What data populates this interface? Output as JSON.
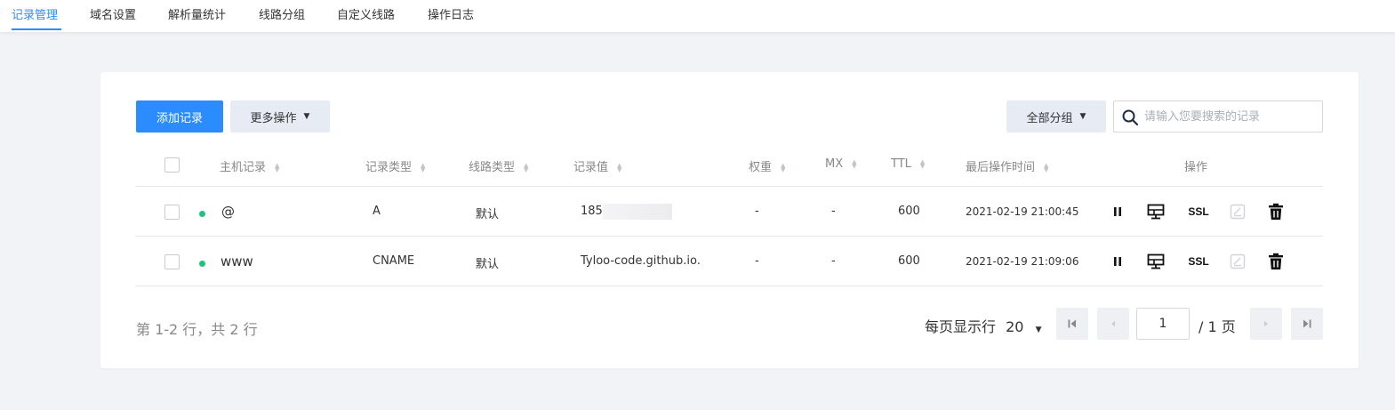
{
  "tabs": [
    {
      "label": "记录管理",
      "active": true
    },
    {
      "label": "域名设置"
    },
    {
      "label": "解析量统计"
    },
    {
      "label": "线路分组"
    },
    {
      "label": "自定义线路"
    },
    {
      "label": "操作日志"
    }
  ],
  "toolbar": {
    "add_label": "添加记录",
    "more_label": "更多操作",
    "group_label": "全部分组",
    "search_placeholder": "请输入您要搜索的记录"
  },
  "table": {
    "headers": {
      "host": "主机记录",
      "type": "记录类型",
      "line": "线路类型",
      "value": "记录值",
      "weight": "权重",
      "mx": "MX",
      "ttl": "TTL",
      "time": "最后操作时间",
      "action": "操作"
    },
    "rows": [
      {
        "host": "@",
        "type": "A",
        "line": "默认",
        "value": "185.",
        "weight": "-",
        "mx": "-",
        "ttl": "600",
        "time": "2021-02-19 21:00:45",
        "ssl": "SSL",
        "status_color": "#1fc47a"
      },
      {
        "host": "www",
        "type": "CNAME",
        "line": "默认",
        "value": "Tyloo-code.github.io.",
        "weight": "-",
        "mx": "-",
        "ttl": "600",
        "time": "2021-02-19 21:09:06",
        "ssl": "SSL",
        "status_color": "#1fc47a"
      }
    ]
  },
  "pagination": {
    "summary": "第 1-2 行，共 2 行",
    "per_page_label": "每页显示行",
    "per_page_value": "20",
    "current_page": "1",
    "total_label": "/ 1 页"
  },
  "colors": {
    "accent": "#2a8cff",
    "status_ok": "#1fc47a"
  }
}
